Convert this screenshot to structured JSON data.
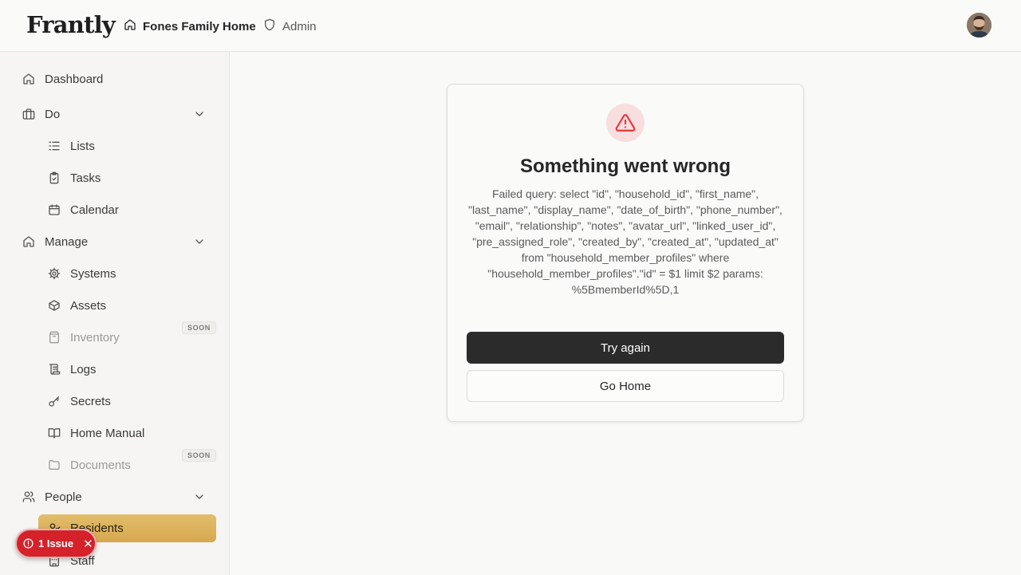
{
  "header": {
    "logo": "Frantly",
    "breadcrumbs": [
      {
        "label": "Fones Family Home",
        "icon": "home-icon"
      },
      {
        "label": "Admin",
        "icon": "shield-icon"
      }
    ]
  },
  "sidebar": {
    "items": [
      {
        "label": "Dashboard",
        "icon": "home-icon"
      },
      {
        "label": "Do",
        "icon": "briefcase-icon"
      },
      {
        "label": "Lists",
        "icon": "list-icon"
      },
      {
        "label": "Tasks",
        "icon": "clipboard-check-icon"
      },
      {
        "label": "Calendar",
        "icon": "calendar-icon"
      },
      {
        "label": "Manage",
        "icon": "home-icon"
      },
      {
        "label": "Systems",
        "icon": "gear-icon"
      },
      {
        "label": "Assets",
        "icon": "box-icon"
      },
      {
        "label": "Inventory",
        "icon": "archive-icon",
        "badge": "SOON"
      },
      {
        "label": "Logs",
        "icon": "scroll-icon"
      },
      {
        "label": "Secrets",
        "icon": "key-icon"
      },
      {
        "label": "Home Manual",
        "icon": "book-icon"
      },
      {
        "label": "Documents",
        "icon": "folder-icon",
        "badge": "SOON"
      },
      {
        "label": "People",
        "icon": "users-icon"
      },
      {
        "label": "Residents",
        "icon": "user-check-icon"
      },
      {
        "label": "Staff",
        "icon": "building-icon"
      }
    ]
  },
  "issue_pill": {
    "label": "1 Issue"
  },
  "error_card": {
    "title": "Something went wrong",
    "message": "Failed query: select \"id\", \"household_id\", \"first_name\", \"last_name\", \"display_name\", \"date_of_birth\", \"phone_number\", \"email\", \"relationship\", \"notes\", \"avatar_url\", \"linked_user_id\", \"pre_assigned_role\", \"created_by\", \"created_at\", \"updated_at\" from \"household_member_profiles\" where \"household_member_profiles\".\"id\" = $1 limit $2 params: %5BmemberId%5D,1",
    "try_again": "Try again",
    "go_home": "Go Home"
  },
  "colors": {
    "accent": "#d9ad55",
    "danger": "#d5212a",
    "primary_button": "#2b2b2b"
  }
}
